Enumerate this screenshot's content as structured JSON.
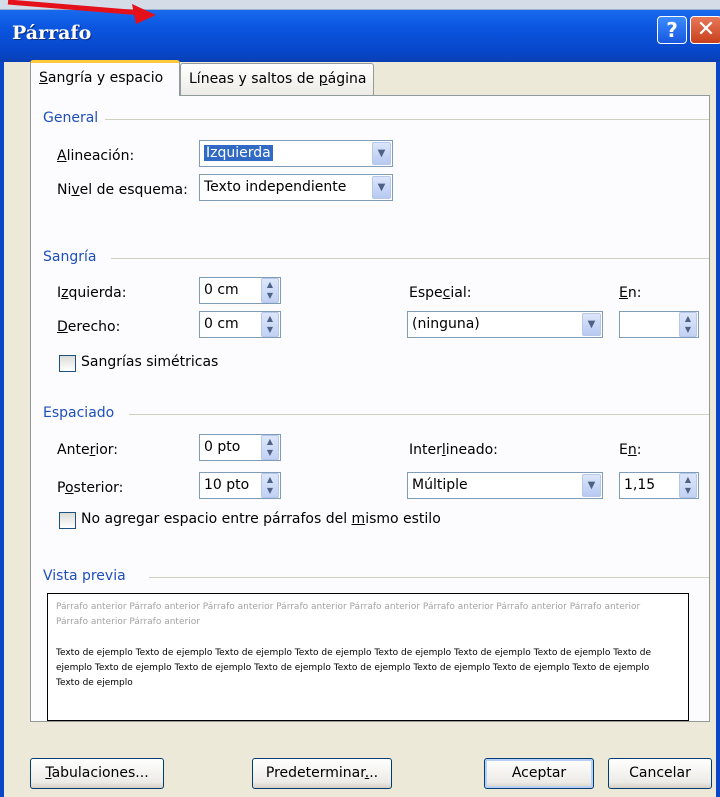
{
  "window": {
    "title": "Párrafo",
    "help_glyph": "?",
    "close_glyph": "✕"
  },
  "tabs": [
    {
      "pre": "",
      "key": "S",
      "post": "angría y espacio"
    },
    {
      "pre": "Líneas y saltos de ",
      "key": "p",
      "post": "ágina"
    }
  ],
  "general": {
    "heading": "General",
    "alineacion": {
      "pre": "",
      "key": "A",
      "post": "lineación:",
      "value": "Izquierda"
    },
    "nivel": {
      "pre": "Ni",
      "key": "v",
      "post": "el de esquema:",
      "value": "Texto independiente"
    }
  },
  "sangria": {
    "heading": "Sangría",
    "izquierda": {
      "pre": "I",
      "key": "z",
      "post": "quierda:",
      "value": "0 cm"
    },
    "derecho": {
      "pre": "",
      "key": "D",
      "post": "erecho:",
      "value": "0 cm"
    },
    "especial": {
      "pre": "Espe",
      "key": "c",
      "post": "ial:",
      "value": "(ninguna)"
    },
    "en": {
      "pre": "",
      "key": "E",
      "post": "n:",
      "value": ""
    },
    "simetricas": "Sangrías simétricas"
  },
  "espaciado": {
    "heading": "Espaciado",
    "anterior": {
      "pre": "Ante",
      "key": "r",
      "post": "ior:",
      "value": "0 pto"
    },
    "posterior": {
      "pre": "P",
      "key": "o",
      "post": "sterior:",
      "value": "10 pto"
    },
    "interlineado": {
      "pre": "Inter",
      "key": "l",
      "post": "ineado:",
      "value": "Múltiple"
    },
    "en": {
      "pre": "E",
      "key": "n",
      "post": ":",
      "value": "1,15"
    },
    "no_agregar": {
      "pre": "No agregar espacio entre párrafos del ",
      "key": "m",
      "post": "ismo estilo"
    }
  },
  "vista_previa": {
    "heading": "Vista previa",
    "previous_text": "Párrafo anterior Párrafo anterior Párrafo anterior Párrafo anterior Párrafo anterior Párrafo anterior Párrafo anterior Párrafo anterior Párrafo anterior Párrafo anterior",
    "sample_text": "Texto de ejemplo Texto de ejemplo Texto de ejemplo Texto de ejemplo Texto de ejemplo Texto de ejemplo Texto de ejemplo Texto de ejemplo Texto de ejemplo Texto de ejemplo Texto de ejemplo Texto de ejemplo Texto de ejemplo Texto de ejemplo Texto de ejemplo Texto de ejemplo"
  },
  "buttons": {
    "tabulaciones": {
      "pre": "",
      "key": "T",
      "post": "abulaciones..."
    },
    "predeterminar": {
      "pre": "Predeterminar",
      "key": ".",
      "post": ".."
    },
    "aceptar": "Aceptar",
    "cancelar": "Cancelar"
  },
  "colors": {
    "titlebar": "#0b55df",
    "section_heading": "#1e4fbd",
    "selection": "#316ac5"
  }
}
